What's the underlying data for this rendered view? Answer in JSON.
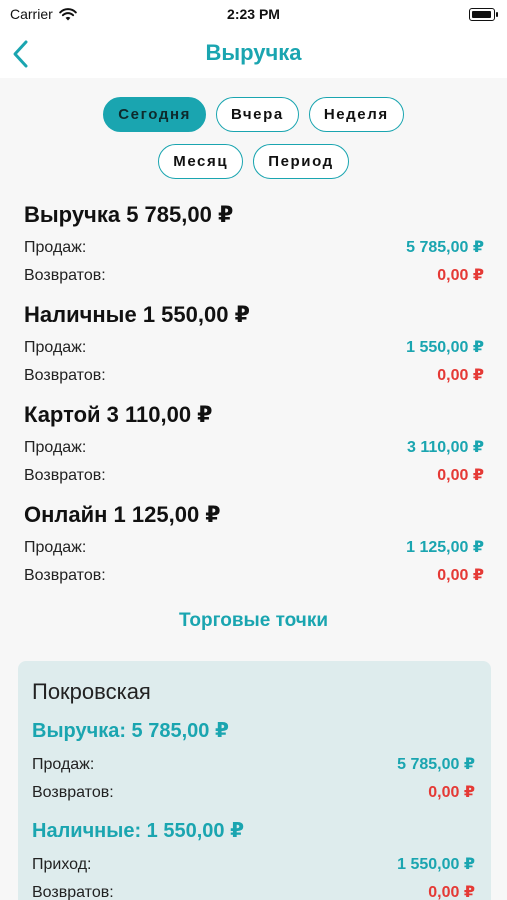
{
  "status": {
    "carrier": "Carrier",
    "time": "2:23 PM",
    "battery_level": 0.95
  },
  "nav": {
    "title": "Выручка"
  },
  "filters": {
    "row1": [
      "Сегодня",
      "Вчера",
      "Неделя"
    ],
    "row2": [
      "Месяц",
      "Период"
    ],
    "active": "Сегодня"
  },
  "summary": [
    {
      "title": "Выручка 5 785,00 ₽",
      "sales_label": "Продаж:",
      "sales": "5 785,00 ₽",
      "returns_label": "Возвратов:",
      "returns": "0,00 ₽"
    },
    {
      "title": "Наличные 1 550,00 ₽",
      "sales_label": "Продаж:",
      "sales": "1 550,00 ₽",
      "returns_label": "Возвратов:",
      "returns": "0,00 ₽"
    },
    {
      "title": "Картой 3 110,00 ₽",
      "sales_label": "Продаж:",
      "sales": "3 110,00 ₽",
      "returns_label": "Возвратов:",
      "returns": "0,00 ₽"
    },
    {
      "title": "Онлайн 1 125,00 ₽",
      "sales_label": "Продаж:",
      "sales": "1 125,00 ₽",
      "returns_label": "Возвратов:",
      "returns": "0,00 ₽"
    }
  ],
  "outlets_title": "Торговые точки",
  "outlet": {
    "name": "Покровская",
    "revenue_title": "Выручка: 5 785,00 ₽",
    "revenue_sales_label": "Продаж:",
    "revenue_sales": "5 785,00 ₽",
    "revenue_returns_label": "Возвратов:",
    "revenue_returns": "0,00 ₽",
    "cash_title": "Наличные:  1 550,00 ₽",
    "cash_in_label": "Приход:",
    "cash_in": "1 550,00 ₽",
    "cash_returns_label": "Возвратов:",
    "cash_returns": "0,00 ₽"
  },
  "colors": {
    "accent": "#1aa5b0",
    "negative": "#e53935",
    "card_bg": "#deeced"
  }
}
